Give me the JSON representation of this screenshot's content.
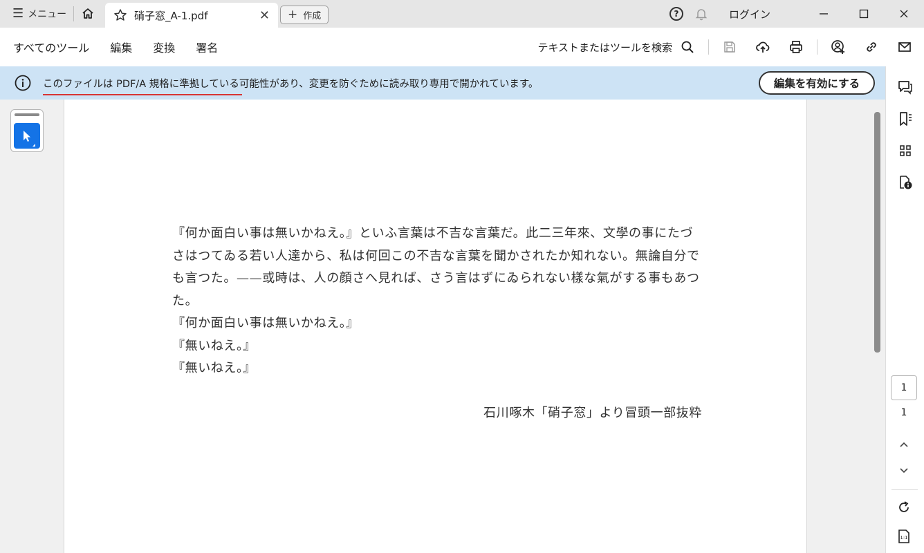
{
  "titlebar": {
    "menu_label": "メニュー",
    "tab_title": "硝子窓_A-1.pdf",
    "create_label": "作成",
    "login_label": "ログイン"
  },
  "toolbar": {
    "items": [
      "すべてのツール",
      "編集",
      "変換",
      "署名"
    ],
    "search_label": "テキストまたはツールを検索"
  },
  "banner": {
    "message": "このファイルは PDF/A 規格に準拠している可能性があり、変更を防ぐために読み取り専用で開かれています。",
    "enable_button": "編集を有効にする"
  },
  "document": {
    "lines": [
      "『何か面白い事は無いかねえ。』といふ言葉は不吉な言葉だ。此二三年來、文學の事にたづ",
      "さはつてゐる若い人達から、私は何回この不吉な言葉を聞かされたか知れない。無論自分で",
      "も言つた。——或時は、人の顔さへ見れば、さう言はずにゐられない樣な氣がする事もあつ",
      "た。",
      "『何か面白い事は無いかねえ。』",
      "『無いねえ。』",
      "『無いねえ。』"
    ],
    "citation": "石川啄木「硝子窓」より冒頭一部抜粋"
  },
  "pagination": {
    "current_page": "1",
    "total_pages": "1"
  },
  "colors": {
    "banner_bg": "#cde3f5",
    "accent_blue": "#1473e6",
    "underline_red": "#d83434"
  }
}
